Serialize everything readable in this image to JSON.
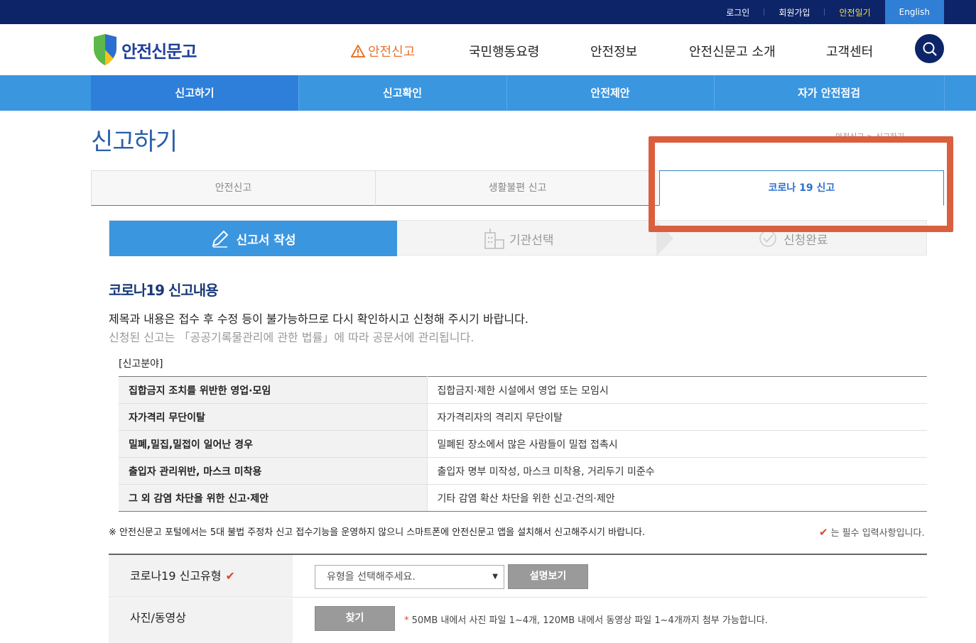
{
  "topbar": {
    "login": "로그인",
    "signup": "회원가입",
    "safety_diary": "안전일기",
    "english": "English"
  },
  "header": {
    "logo_text": "안전신문고",
    "gnb": [
      "안전신고",
      "국민행동요령",
      "안전정보",
      "안전신문고 소개",
      "고객센터"
    ]
  },
  "subnav": [
    "신고하기",
    "신고확인",
    "안전제안",
    "자가 안전점검"
  ],
  "page": {
    "title": "신고하기",
    "breadcrumb": "안전신고 > 신고하기"
  },
  "tabs": [
    "안전신고",
    "생활불편 신고",
    "코로나 19 신고"
  ],
  "steps": [
    "신고서 작성",
    "기관선택",
    "신청완료"
  ],
  "section": {
    "title": "코로나19 신고내용",
    "notice1": "제목과 내용은 접수 후 수정 등이 불가능하므로 다시 확인하시고 신청해 주시기 바랍니다.",
    "notice2": "신청된 신고는 「공공기록물관리에 관한 법률」에 따라 공문서에 관리됩니다.",
    "field_caption": "[신고분야]"
  },
  "fields": [
    {
      "k": "집합금지 조치를 위반한 영업·모임",
      "v": "집합금지·제한 시설에서 영업 또는 모임시"
    },
    {
      "k": "자가격리 무단이탈",
      "v": "자가격리자의 격리지 무단이탈"
    },
    {
      "k": "밀폐,밀집,밀접이 일어난 경우",
      "v": "밀폐된 장소에서 많은 사람들이 밀접 접촉시"
    },
    {
      "k": "출입자 관리위반, 마스크 미착용",
      "v": "출입자 명부 미작성, 마스크 미착용, 거리두기 미준수"
    },
    {
      "k": "그 외 감염 차단을 위한 신고·제안",
      "v": "기타 감염 확산 차단을 위한 신고·건의·제안"
    }
  ],
  "notes": {
    "warning": "※ 안전신문고 포털에서는 5대 불법 주정차 신고 접수기능을 운영하지 않으니 스마트폰에 안전신문고 앱을 설치해서 신고해주시기 바랍니다.",
    "required": "는 필수 입력사항입니다."
  },
  "form": {
    "type_label": "코로나19 신고유형",
    "select_placeholder": "유형을 선택해주세요.",
    "explain_button": "설명보기",
    "media_label": "사진/동영상",
    "find_button": "찾기",
    "file_note": "50MB 내에서 사진 파일 1~4개, 120MB 내에서 동영상 파일 1~4개까지 첨부 가능합니다."
  },
  "colors": {
    "navy": "#0d2468",
    "blue": "#3b96e0",
    "highlight": "#d95f3e",
    "accent_orange": "#e8722a"
  }
}
